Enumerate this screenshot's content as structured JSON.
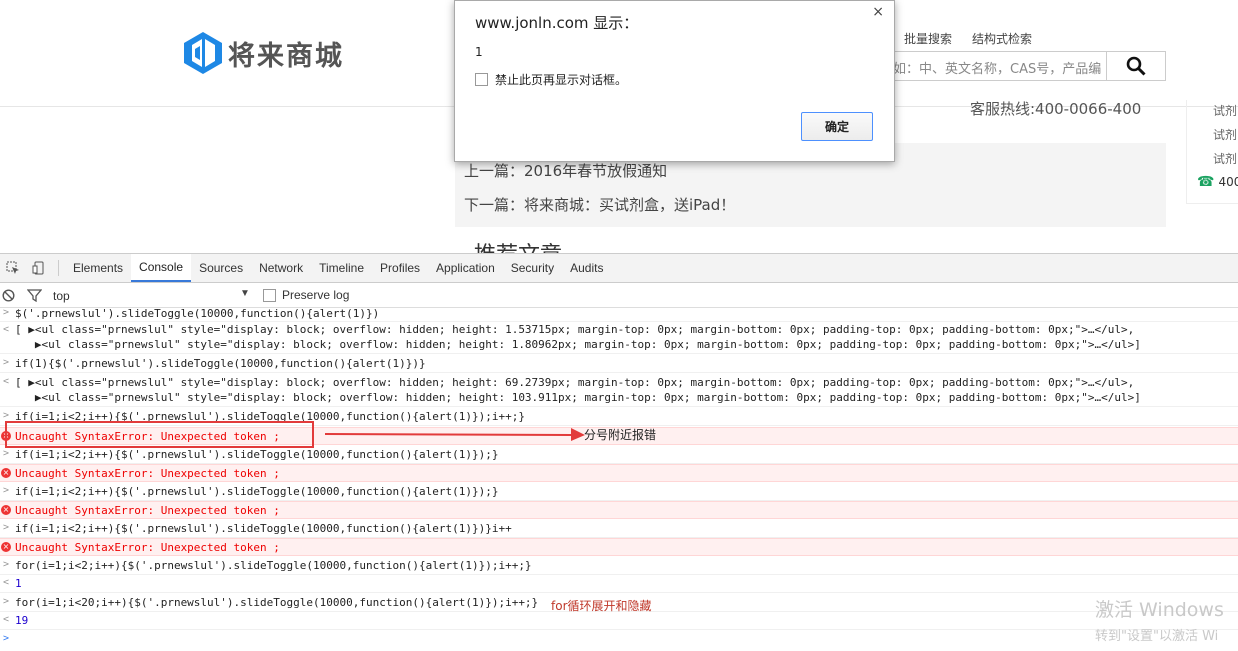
{
  "site": {
    "logo_text": "将来商城",
    "toplinks": [
      "批量搜索",
      "结构式检索"
    ],
    "search_placeholder": "如：中、英文名称，CAS号，产品编",
    "hotline": "客服热线:400-0066-400",
    "side_items": [
      "试剂",
      "试剂",
      "试剂"
    ],
    "side_phone": "400",
    "prev_article": "上一篇：2016年春节放假通知",
    "next_article": "下一篇：将来商城：买试剂盒，送iPad！",
    "recommend_title": "推荐文章"
  },
  "dialog": {
    "title": "www.jonln.com 显示：",
    "message": "1",
    "checkbox_label": "禁止此页再显示对话框。",
    "ok_label": "确定",
    "close_glyph": "×"
  },
  "devtools": {
    "tabs": [
      "Elements",
      "Console",
      "Sources",
      "Network",
      "Timeline",
      "Profiles",
      "Application",
      "Security",
      "Audits"
    ],
    "active_tab": "Console",
    "context": "top",
    "preserve_log": "Preserve log",
    "console_lines": [
      "$('.prnewslul').slideToggle(10000,function(){alert(1)})",
      "[ ▶<ul class=\"prnewslul\" style=\"display: block; overflow: hidden; height: 1.53715px; margin-top: 0px; margin-bottom: 0px; padding-top: 0px; padding-bottom: 0px;\">…</ul>,",
      "   ▶<ul class=\"prnewslul\" style=\"display: block; overflow: hidden; height: 1.80962px; margin-top: 0px; margin-bottom: 0px; padding-top: 0px; padding-bottom: 0px;\">…</ul>]",
      "if(1){$('.prnewslul').slideToggle(10000,function(){alert(1)})}",
      "[ ▶<ul class=\"prnewslul\" style=\"display: block; overflow: hidden; height: 69.2739px; margin-top: 0px; margin-bottom: 0px; padding-top: 0px; padding-bottom: 0px;\">…</ul>,",
      "   ▶<ul class=\"prnewslul\" style=\"display: block; overflow: hidden; height: 103.911px; margin-top: 0px; margin-bottom: 0px; padding-top: 0px; padding-bottom: 0px;\">…</ul>]",
      "if(i=1;i<2;i++){$('.prnewslul').slideToggle(10000,function(){alert(1)});i++;}",
      "Uncaught SyntaxError: Unexpected token ;",
      "if(i=1;i<2;i++){$('.prnewslul').slideToggle(10000,function(){alert(1)});}",
      "Uncaught SyntaxError: Unexpected token ;",
      "if(i=1;i<2;i++){$('.prnewslul').slideToggle(10000,function(){alert(1)});}",
      "Uncaught SyntaxError: Unexpected token ;",
      "if(i=1;i<2;i++){$('.prnewslul').slideToggle(10000,function(){alert(1)})}i++",
      "Uncaught SyntaxError: Unexpected token ;",
      "for(i=1;i<2;i++){$('.prnewslul').slideToggle(10000,function(){alert(1)});i++;}",
      "1",
      "for(i=1;i<20;i++){$('.prnewslul').slideToggle(10000,function(){alert(1)});i++;}",
      "19"
    ],
    "annotation_error": "分号附近报错",
    "annotation_loop": "for循环展开和隐藏"
  },
  "watermark": {
    "line1": "激活 Windows",
    "line2": "转到\"设置\"以激活 Wi"
  },
  "colors": {
    "accent": "#3879d9",
    "error": "#e00000",
    "error_bg": "#fff0f0",
    "logo_blue": "#1e88e5"
  }
}
